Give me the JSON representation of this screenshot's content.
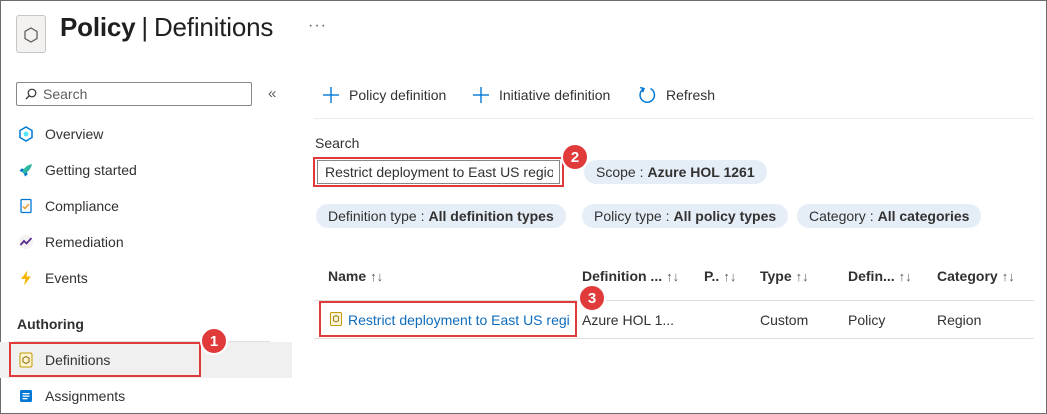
{
  "header": {
    "title_bold": "Policy",
    "title_sep": "|",
    "title_rest": "Definitions",
    "more": "···",
    "icon": "policy-hexagon-icon"
  },
  "sidebar": {
    "search_placeholder": "Search",
    "collapse": "«",
    "items": [
      {
        "label": "Overview",
        "icon": "overview-icon"
      },
      {
        "label": "Getting started",
        "icon": "rocket-icon"
      },
      {
        "label": "Compliance",
        "icon": "compliance-icon"
      },
      {
        "label": "Remediation",
        "icon": "remediation-icon"
      },
      {
        "label": "Events",
        "icon": "lightning-icon"
      }
    ],
    "section": "Authoring",
    "authoring_items": [
      {
        "label": "Definitions",
        "icon": "definitions-icon",
        "active": true
      },
      {
        "label": "Assignments",
        "icon": "assignments-icon"
      }
    ]
  },
  "toolbar": {
    "policy_definition": "Policy definition",
    "initiative_definition": "Initiative definition",
    "refresh": "Refresh"
  },
  "search": {
    "label": "Search",
    "value": "Restrict deployment to East US region"
  },
  "filters": {
    "scope_label": "Scope :",
    "scope_value": "Azure HOL 1261",
    "definition_type_label": "Definition type :",
    "definition_type_value": "All definition types",
    "policy_type_label": "Policy type :",
    "policy_type_value": "All policy types",
    "category_label": "Category :",
    "category_value": "All categories"
  },
  "table": {
    "sort_glyph": "↑↓",
    "columns": [
      "Name",
      "Definition ...",
      "P..",
      "Type",
      "Defin...",
      "Category"
    ],
    "rows": [
      {
        "name": "Restrict deployment to East US region",
        "definition_location": "Azure HOL 1...",
        "policies": "",
        "type": "Custom",
        "definition_type": "Policy",
        "category": "Region"
      }
    ]
  },
  "annotations": [
    "1",
    "2",
    "3"
  ],
  "colors": {
    "accent": "#0f6cbd",
    "annotation": "#e03a3a",
    "pill": "#e5eef7"
  }
}
